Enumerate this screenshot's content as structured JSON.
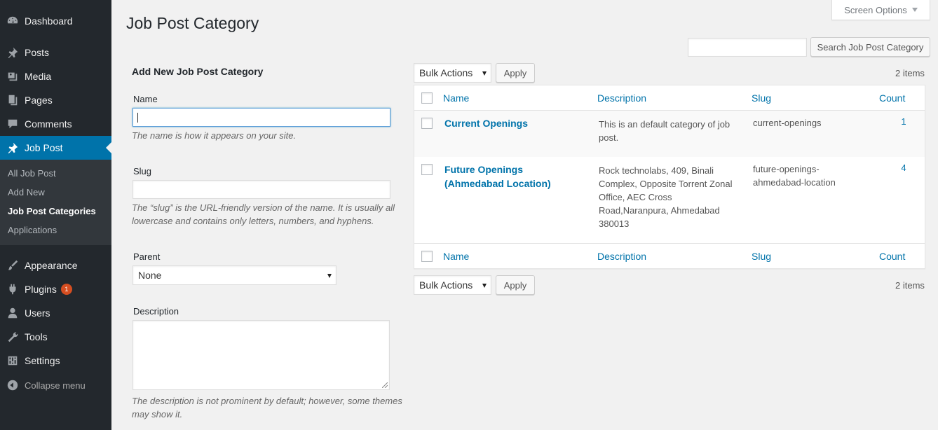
{
  "sidebar": {
    "items": [
      {
        "label": "Dashboard",
        "icon": "dashboard-icon"
      },
      {
        "label": "Posts",
        "icon": "pin-icon"
      },
      {
        "label": "Media",
        "icon": "media-icon"
      },
      {
        "label": "Pages",
        "icon": "pages-icon"
      },
      {
        "label": "Comments",
        "icon": "comment-icon"
      },
      {
        "label": "Job Post",
        "icon": "pin-icon",
        "current": true
      },
      {
        "label": "Appearance",
        "icon": "brush-icon"
      },
      {
        "label": "Plugins",
        "icon": "plug-icon",
        "badge": "1"
      },
      {
        "label": "Users",
        "icon": "user-icon"
      },
      {
        "label": "Tools",
        "icon": "wrench-icon"
      },
      {
        "label": "Settings",
        "icon": "settings-icon"
      }
    ],
    "submenu": [
      "All Job Post",
      "Add New",
      "Job Post Categories",
      "Applications"
    ],
    "collapse_label": "Collapse menu"
  },
  "header": {
    "title": "Job Post Category",
    "screen_options": "Screen Options"
  },
  "search": {
    "value": "",
    "button": "Search Job Post Category"
  },
  "form": {
    "title": "Add New Job Post Category",
    "name_label": "Name",
    "name_value": "",
    "name_help": "The name is how it appears on your site.",
    "slug_label": "Slug",
    "slug_value": "",
    "slug_help": "The “slug” is the URL-friendly version of the name. It is usually all lowercase and contains only letters, numbers, and hyphens.",
    "parent_label": "Parent",
    "parent_value": "None",
    "description_label": "Description",
    "description_help": "The description is not prominent by default; however, some themes may show it."
  },
  "table": {
    "bulk_actions": "Bulk Actions",
    "apply": "Apply",
    "items_count": "2 items",
    "columns": [
      "Name",
      "Description",
      "Slug",
      "Count"
    ],
    "rows": [
      {
        "name": "Current Openings",
        "description": "This is an default category of job post.",
        "slug": "current-openings",
        "count": "1"
      },
      {
        "name": "Future Openings (Ahmedabad Location)",
        "description": "Rock technolabs, 409, Binali Complex, Opposite Torrent Zonal Office, AEC Cross Road,Naranpura, Ahmedabad 380013",
        "slug": "future-openings-ahmedabad-location",
        "count": "4"
      }
    ]
  },
  "colors": {
    "sidebar_bg": "#23282d",
    "accent": "#0073aa",
    "badge": "#d54e21"
  }
}
